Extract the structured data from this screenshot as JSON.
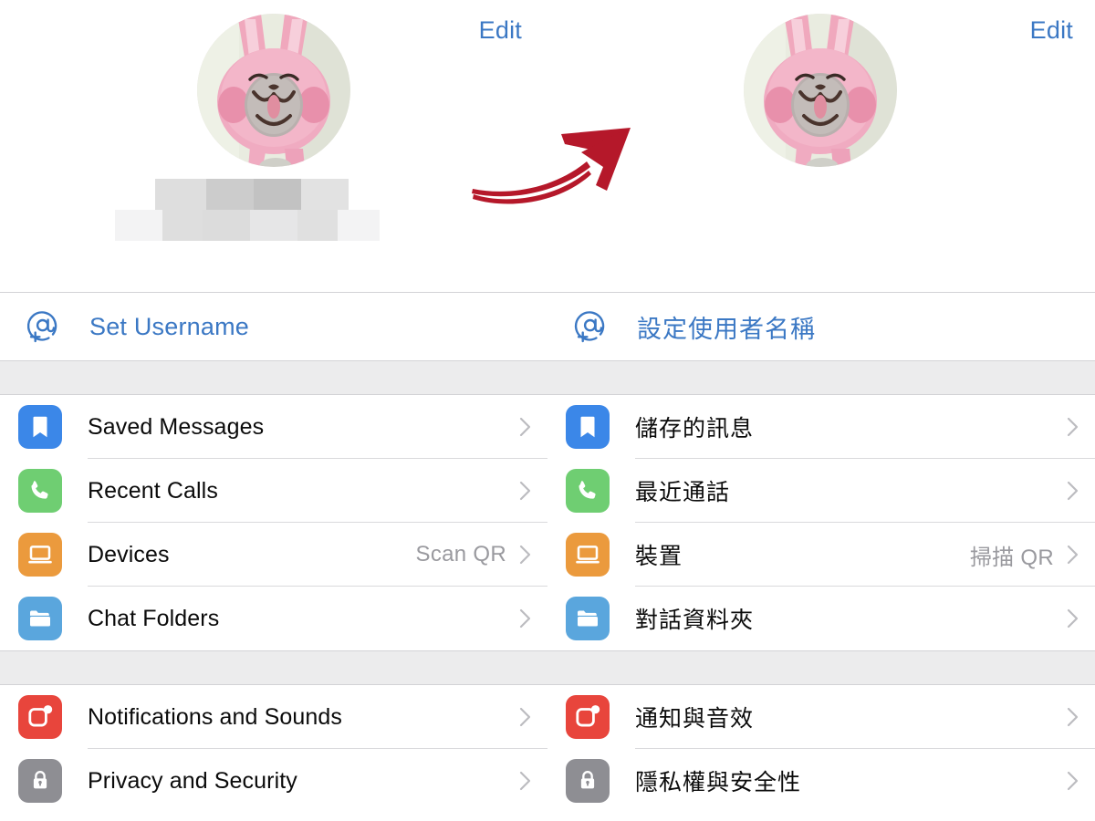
{
  "meta": {
    "app": "Telegram Settings",
    "accent_blue": "#3b78c4",
    "arrow_color": "#b5182a",
    "section_gap_color": "#ececed",
    "separator_color": "#d9d9dc",
    "value_text_color": "#9a9a9f"
  },
  "panels": [
    {
      "lang": "en",
      "edit_label": "Edit",
      "avatar_alt": "pink-bunny-plush-photo",
      "name_blurred": true,
      "username_row": {
        "icon": "at-plus-icon",
        "label": "Set Username"
      },
      "sections": [
        {
          "rows": [
            {
              "icon": "bookmark-icon",
              "icon_color": "#3b87e8",
              "label": "Saved Messages",
              "value": "",
              "chevron": true
            },
            {
              "icon": "phone-icon",
              "icon_color": "#6fce72",
              "label": "Recent Calls",
              "value": "",
              "chevron": true
            },
            {
              "icon": "laptop-icon",
              "icon_color": "#eb9a3d",
              "label": "Devices",
              "value": "Scan QR",
              "chevron": true
            },
            {
              "icon": "folder-icon",
              "icon_color": "#5aa6dd",
              "label": "Chat Folders",
              "value": "",
              "chevron": true
            }
          ]
        },
        {
          "rows": [
            {
              "icon": "notification-bell-badge-icon",
              "icon_color": "#e8453c",
              "label": "Notifications and Sounds",
              "value": "",
              "chevron": true
            },
            {
              "icon": "lock-icon",
              "icon_color": "#8e8e93",
              "label": "Privacy and Security",
              "value": "",
              "chevron": true
            }
          ]
        }
      ]
    },
    {
      "lang": "zh-Hant",
      "edit_label": "Edit",
      "avatar_alt": "pink-bunny-plush-photo",
      "name_blurred": true,
      "username_row": {
        "icon": "at-plus-icon",
        "label": "設定使用者名稱"
      },
      "sections": [
        {
          "rows": [
            {
              "icon": "bookmark-icon",
              "icon_color": "#3b87e8",
              "label": "儲存的訊息",
              "value": "",
              "chevron": true
            },
            {
              "icon": "phone-icon",
              "icon_color": "#6fce72",
              "label": "最近通話",
              "value": "",
              "chevron": true
            },
            {
              "icon": "laptop-icon",
              "icon_color": "#eb9a3d",
              "label": "裝置",
              "value": "掃描 QR",
              "chevron": true
            },
            {
              "icon": "folder-icon",
              "icon_color": "#5aa6dd",
              "label": "對話資料夾",
              "value": "",
              "chevron": true
            }
          ]
        },
        {
          "rows": [
            {
              "icon": "notification-bell-badge-icon",
              "icon_color": "#e8453c",
              "label": "通知與音效",
              "value": "",
              "chevron": true
            },
            {
              "icon": "lock-icon",
              "icon_color": "#8e8e93",
              "label": "隱私權與安全性",
              "value": "",
              "chevron": true
            }
          ]
        }
      ]
    }
  ],
  "annotation": {
    "type": "curved-arrow",
    "direction": "left-to-right-up",
    "color": "#b5182a"
  }
}
